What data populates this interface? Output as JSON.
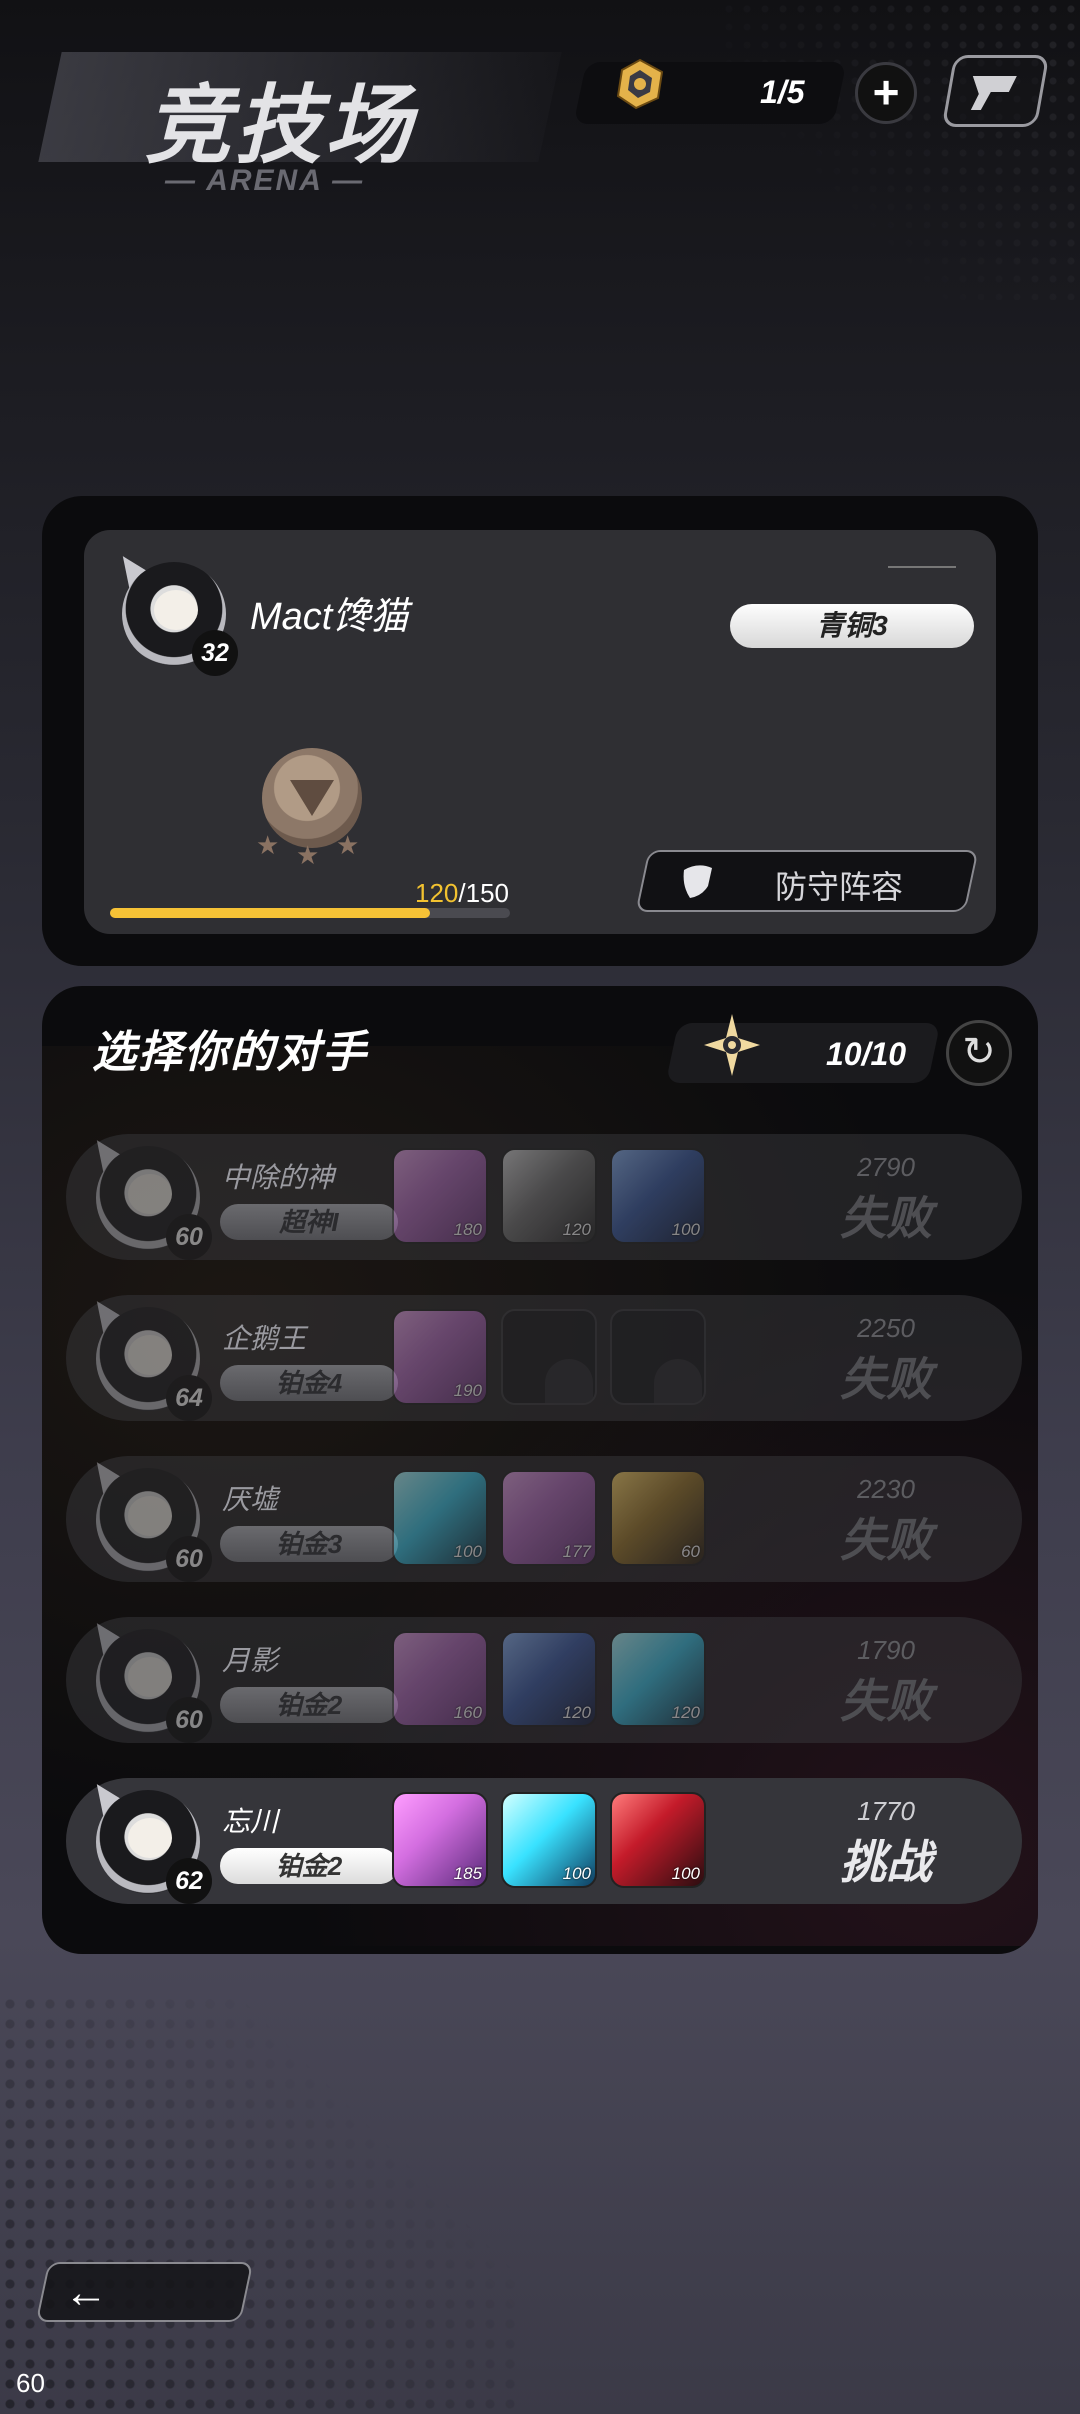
{
  "header": {
    "title": "竞技场",
    "subtitle": "— ARENA —",
    "ticket_count": "1/5"
  },
  "profile": {
    "name": "Mact馋猫",
    "level": "32",
    "rank": "青铜3",
    "progress_current": "120",
    "progress_max": "/150",
    "progress_fraction": 0.8,
    "defense_label": "防守阵容"
  },
  "opponents_panel": {
    "title": "选择你的对手",
    "attempts": "10/10"
  },
  "opponents": [
    {
      "name": "中除的神",
      "level": "60",
      "rank": "超神I",
      "score": "2790",
      "result": "失败",
      "heroes": [
        {
          "style": "h-purple",
          "level": "180"
        },
        {
          "style": "h-silver",
          "level": "120"
        },
        {
          "style": "h-blue",
          "level": "100"
        }
      ]
    },
    {
      "name": "企鹅王",
      "level": "64",
      "rank": "铂金4",
      "score": "2250",
      "result": "失败",
      "heroes": [
        {
          "style": "h-purple",
          "level": "190"
        },
        {
          "style": "empty",
          "level": ""
        },
        {
          "style": "empty",
          "level": ""
        }
      ]
    },
    {
      "name": "厌墟",
      "level": "60",
      "rank": "铂金3",
      "score": "2230",
      "result": "失败",
      "heroes": [
        {
          "style": "h-cyan",
          "level": "100"
        },
        {
          "style": "h-purple",
          "level": "177"
        },
        {
          "style": "h-gold",
          "level": "60"
        }
      ]
    },
    {
      "name": "月影",
      "level": "60",
      "rank": "铂金2",
      "score": "1790",
      "result": "失败",
      "heroes": [
        {
          "style": "h-purple",
          "level": "160"
        },
        {
          "style": "h-blue",
          "level": "120"
        },
        {
          "style": "h-cyan",
          "level": "120"
        }
      ]
    },
    {
      "name": "忘川",
      "level": "62",
      "rank": "铂金2",
      "score": "1770",
      "result": "挑战",
      "heroes": [
        {
          "style": "h-purple-b",
          "level": "185"
        },
        {
          "style": "h-cyan-b",
          "level": "100"
        },
        {
          "style": "h-red",
          "level": "100"
        }
      ]
    }
  ],
  "footer": {
    "back_icon": "arrow-left-icon",
    "fps": "60"
  },
  "colors": {
    "progress_fill": "#f6c236",
    "progress_text": "#f2c230"
  }
}
